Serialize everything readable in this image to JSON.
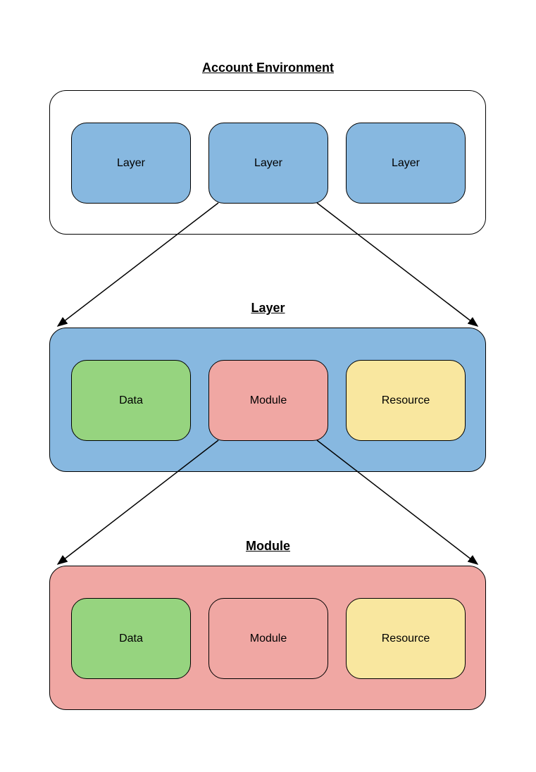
{
  "titles": {
    "account_env": "Account Environment",
    "layer": "Layer",
    "module": "Module"
  },
  "account_env": {
    "boxes": [
      "Layer",
      "Layer",
      "Layer"
    ]
  },
  "layer": {
    "boxes": [
      "Data",
      "Module",
      "Resource"
    ]
  },
  "module": {
    "boxes": [
      "Data",
      "Module",
      "Resource"
    ]
  },
  "colors": {
    "blue": "#87b8e0",
    "green": "#96d47f",
    "pink": "#f0a7a3",
    "yellow": "#f9e79f",
    "white": "#ffffff"
  }
}
